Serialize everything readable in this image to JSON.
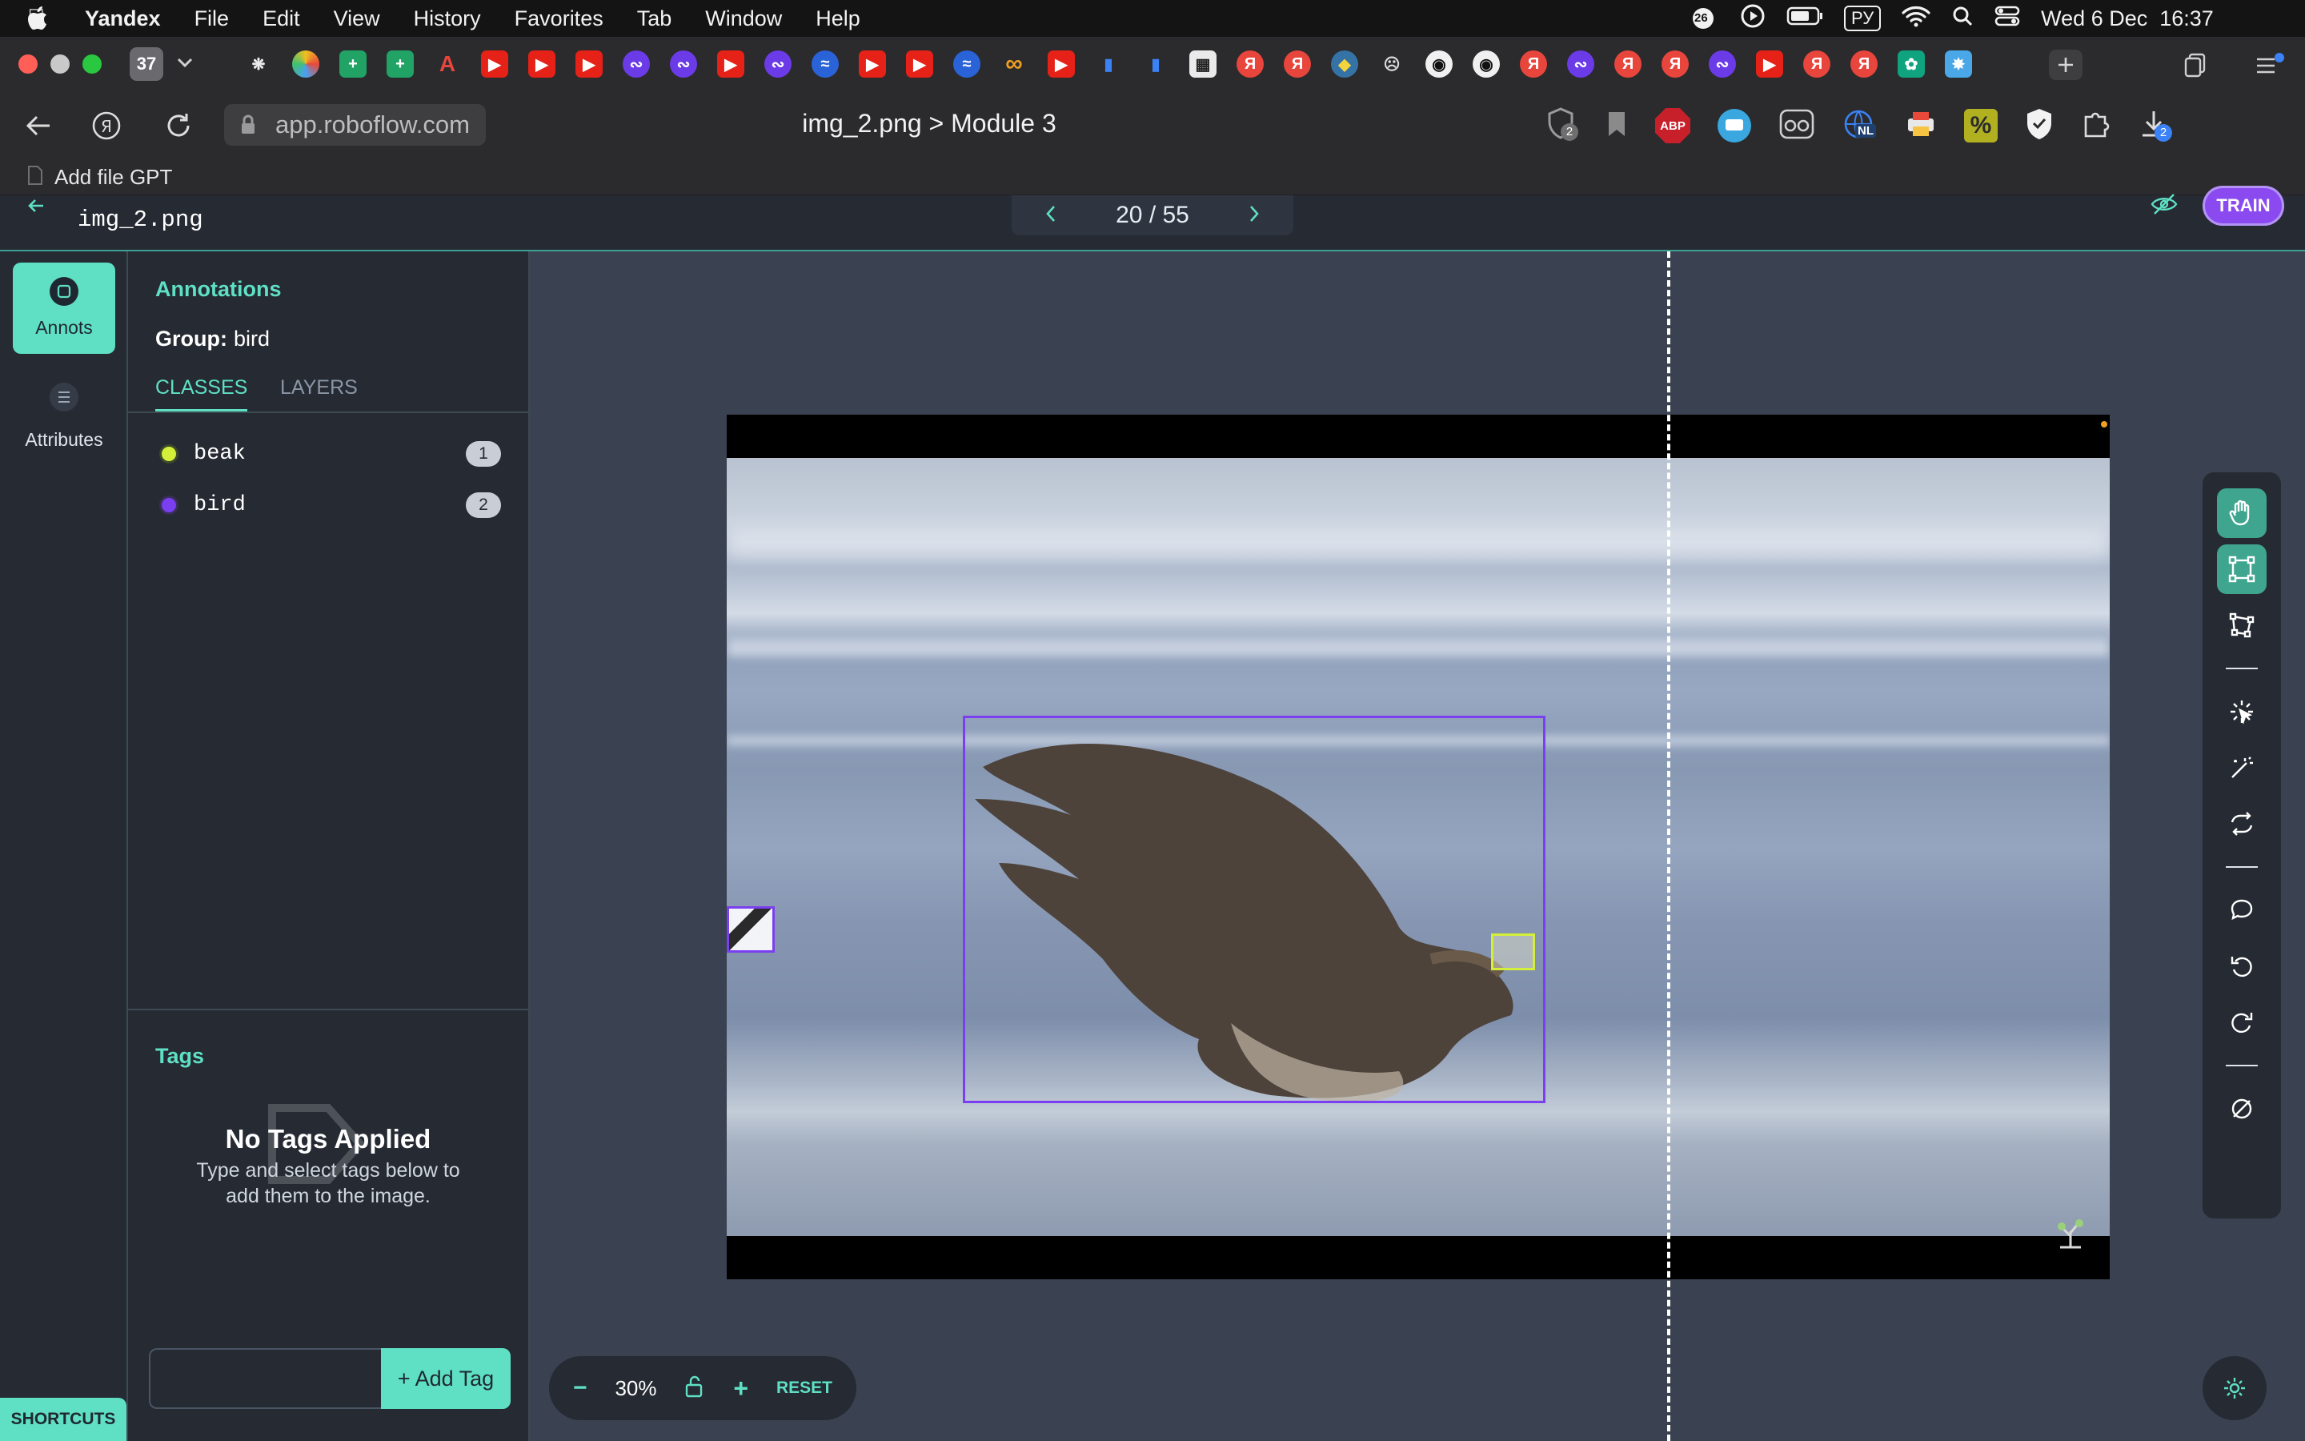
{
  "os_menu": {
    "app_name": "Yandex",
    "items": [
      "File",
      "Edit",
      "View",
      "History",
      "Favorites",
      "Tab",
      "Window",
      "Help"
    ],
    "status": {
      "notifications_badge": "26",
      "keyboard_layout": "РУ",
      "datetime": "Wed 6 Dec  16:37"
    }
  },
  "browser": {
    "tab_count": "37",
    "address": "app.roboflow.com",
    "page_title": "img_2.png > Module 3",
    "bookmark": "Add file GPT",
    "extension_badge_2": "2",
    "download_badge": "2",
    "extensions": [
      {
        "label": "ABP",
        "color": "#c8202b"
      },
      {
        "label": "NL",
        "color": "#1f3f6e"
      }
    ]
  },
  "app": {
    "filename": "img_2.png",
    "pager": "20 / 55",
    "train_label": "TRAIN"
  },
  "leftnav": {
    "annots_label": "Annots",
    "attributes_label": "Attributes",
    "shortcuts_label": "SHORTCUTS"
  },
  "annotations": {
    "title": "Annotations",
    "group_label": "Group:",
    "group_value": "bird",
    "tabs": [
      "CLASSES",
      "LAYERS"
    ],
    "classes": [
      {
        "name": "beak",
        "count": "1",
        "color": "#d4ef3a"
      },
      {
        "name": "bird",
        "count": "2",
        "color": "#7a3ff0"
      }
    ]
  },
  "tags": {
    "title": "Tags",
    "empty_title": "No Tags Applied",
    "empty_desc_1": "Type and select tags below to",
    "empty_desc_2": "add them to the image.",
    "input_placeholder": "",
    "add_label": "+ Add Tag"
  },
  "zoom": {
    "minus": "−",
    "value": "30%",
    "plus": "+",
    "reset": "RESET"
  },
  "colors": {
    "accent": "#5fe0c4",
    "bird_box": "#7a3ff0",
    "beak_box": "#d4ef3a",
    "train": "#8a4af0"
  }
}
